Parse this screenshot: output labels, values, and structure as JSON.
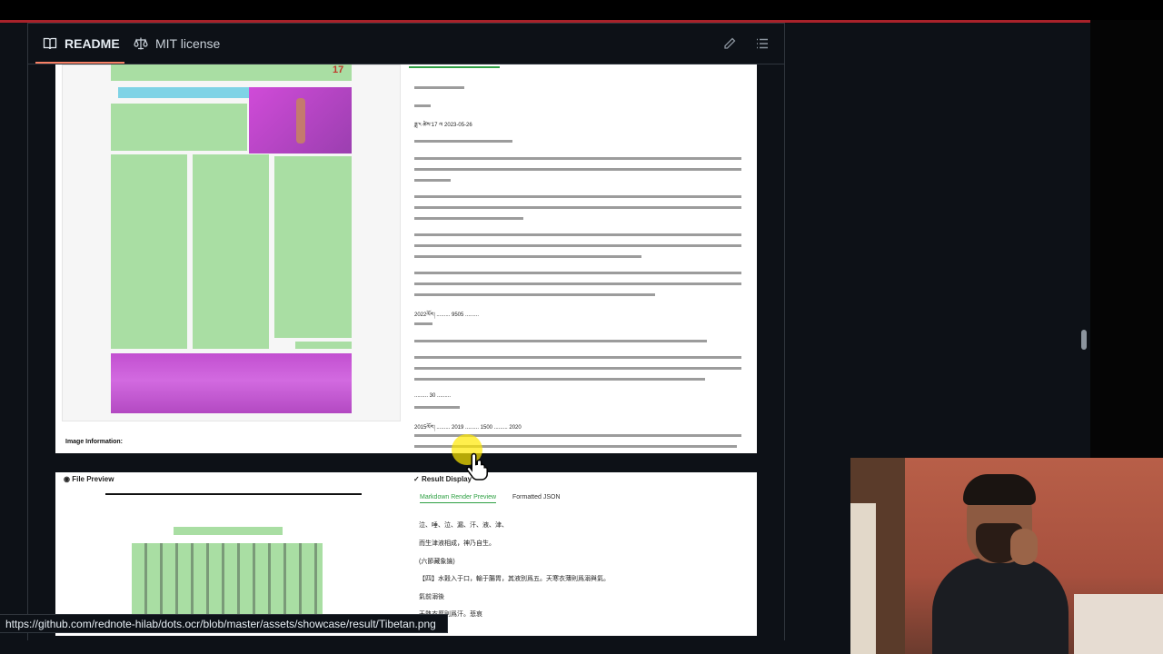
{
  "tabs": {
    "readme": "README",
    "license": "MIT license"
  },
  "image_info_label": "Image Information:",
  "tibetan_preview": {
    "date_line": "ཟླ་༥ ཚེས་17 ལ 2023-05-26",
    "number_line": "2022ལོར། ......... 9505 .........",
    "year_line": "2015ལོར། ......... 2019 ......... 1500 ......... 2020",
    "count_line": "......... 30 ........."
  },
  "lower_sheet": {
    "file_preview_label": "File Preview",
    "result_display_label": "Result Display",
    "subtab_markdown": "Markdown Render Preview",
    "subtab_json": "Formatted JSON",
    "md_lines": [
      "泣、唾、泣、漏、汗、液、津、",
      "而生津液相成，神乃自生。",
      "(六節藏象論)",
      "【四】水穀入于口，輸于腸胃，其液別爲五。天寒衣薄則爲溺與氣。",
      "氣前溺後",
      "天熱衣厚則爲汗。悲哀"
    ]
  },
  "status_url": "https://github.com/rednote-hilab/dots.ocr/blob/master/assets/showcase/result/Tibetan.png",
  "colors": {
    "accent": "#f78166",
    "red_bar": "#a8222a",
    "layout_green": "#a9dea3",
    "layout_pink": "#e05be3"
  }
}
